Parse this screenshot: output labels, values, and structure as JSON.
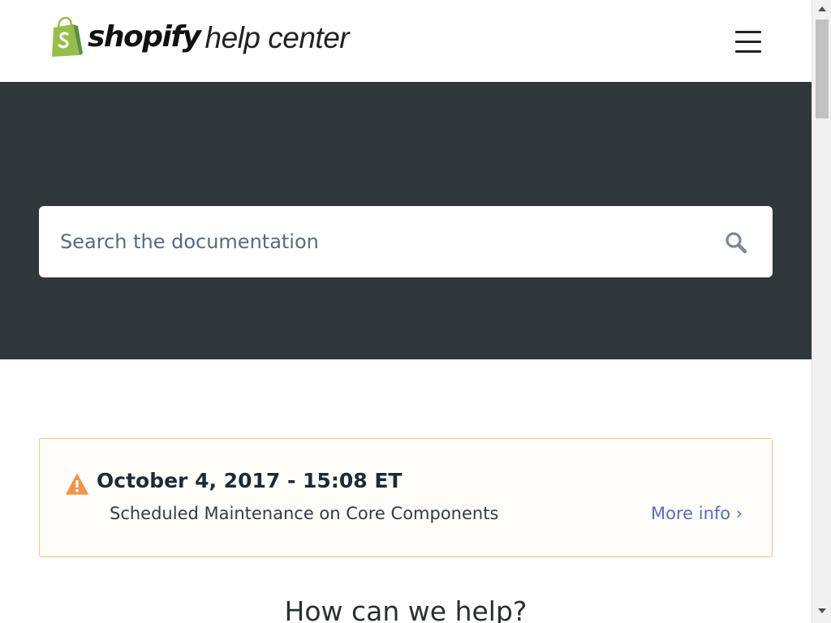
{
  "header": {
    "logo_wordmark": "shopify",
    "logo_sub": "help center",
    "menu_icon": "hamburger-menu-icon"
  },
  "hero": {
    "search": {
      "placeholder": "Search the documentation",
      "value": "",
      "icon": "search-icon"
    }
  },
  "notice": {
    "icon": "warning-icon",
    "date": "October 4, 2017 - 15:08 ET",
    "description": "Scheduled Maintenance on Core Components",
    "link_label": "More info ›"
  },
  "main": {
    "heading": "How can we help?"
  },
  "colors": {
    "hero_bg": "#30373b",
    "brand_green": "#95bf47",
    "link": "#5c6ac4",
    "notice_border": "#f2c382",
    "warning": "#f49342"
  }
}
